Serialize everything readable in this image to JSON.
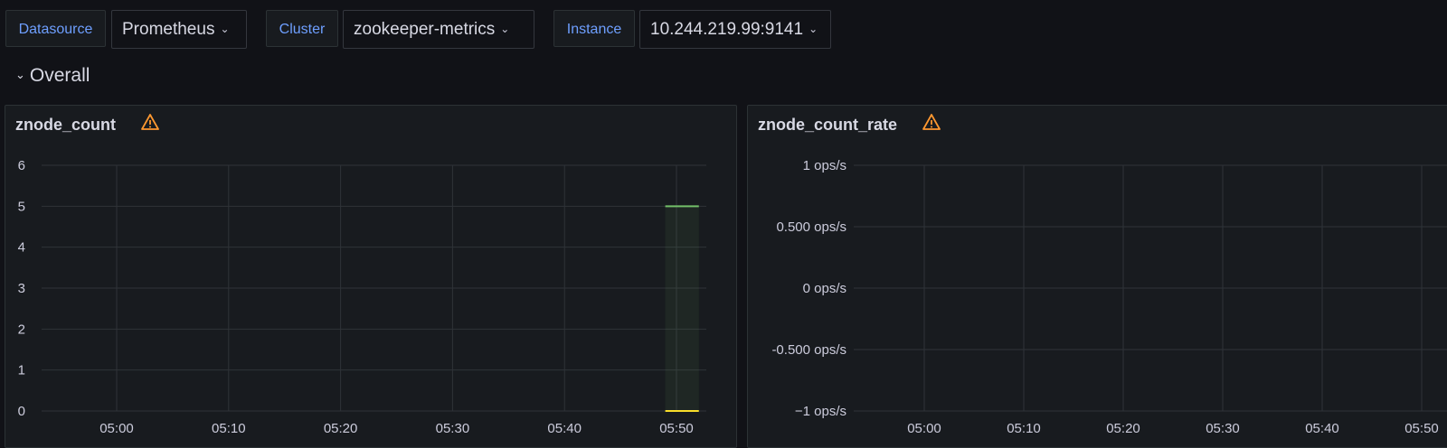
{
  "variables": [
    {
      "label": "Datasource",
      "value": "Prometheus"
    },
    {
      "label": "Cluster",
      "value": "zookeeper-metrics"
    },
    {
      "label": "Instance",
      "value": "10.244.219.99:9141"
    }
  ],
  "row": {
    "title": "Overall"
  },
  "panels": [
    {
      "title": "znode_count"
    },
    {
      "title": "znode_count_rate"
    }
  ],
  "colors": {
    "background": "#111217",
    "panel": "#181b1f",
    "grid": "#2f3338",
    "accent": "#6e9fff",
    "series_green": "#73bf69",
    "series_yellow": "#fade2a",
    "warning": "#ff9830"
  },
  "chart_data": [
    {
      "type": "line",
      "title": "znode_count",
      "x": [
        "05:00",
        "05:10",
        "05:20",
        "05:30",
        "05:40",
        "05:50"
      ],
      "yticks": [
        "0",
        "1",
        "2",
        "3",
        "4",
        "5",
        "6"
      ],
      "ylim": [
        0,
        6
      ],
      "grid": true,
      "series": [
        {
          "color": "#73bf69",
          "points": [
            [
              "05:49",
              5
            ],
            [
              "05:52",
              5
            ]
          ]
        },
        {
          "color": "#fade2a",
          "points": [
            [
              "05:49",
              0
            ],
            [
              "05:52",
              0
            ]
          ]
        }
      ]
    },
    {
      "type": "line",
      "title": "znode_count_rate",
      "x": [
        "05:00",
        "05:10",
        "05:20",
        "05:30",
        "05:40",
        "05:50"
      ],
      "yticks": [
        "1 ops/s",
        "0.500 ops/s",
        "0 ops/s",
        "-0.500 ops/s",
        "−1 ops/s"
      ],
      "ylim": [
        -1,
        1
      ],
      "grid": true,
      "series": []
    }
  ]
}
